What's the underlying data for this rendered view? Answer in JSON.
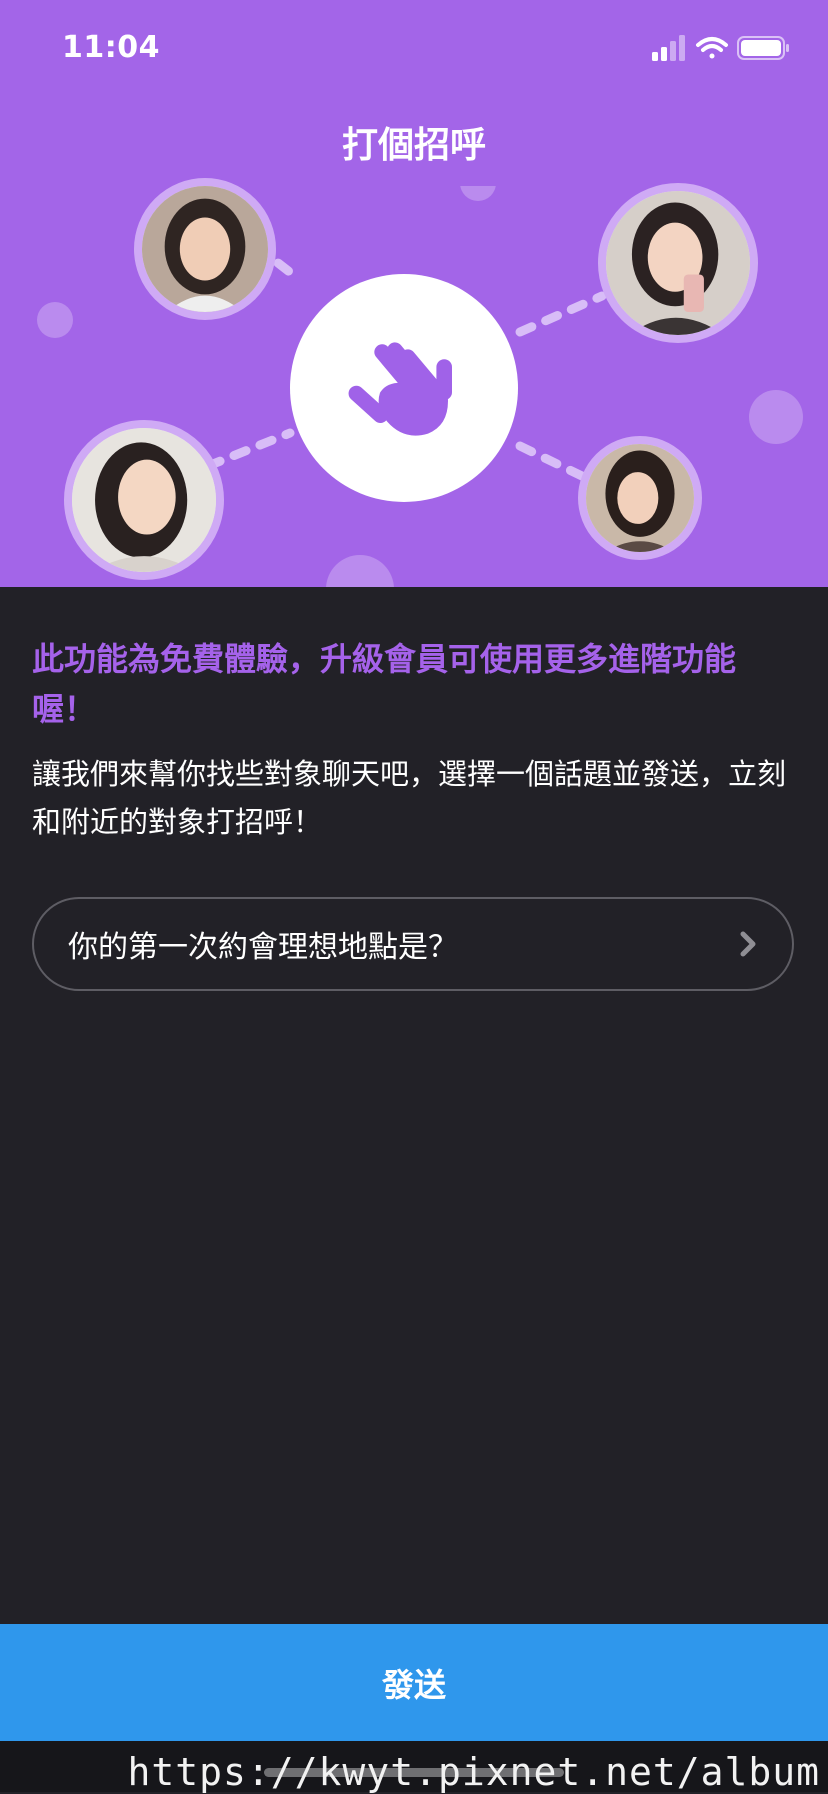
{
  "status_bar": {
    "time": "11:04",
    "icons": [
      "cellular-signal-icon",
      "wifi-icon",
      "battery-icon"
    ]
  },
  "header": {
    "title": "打個招呼"
  },
  "illustration": {
    "center_icon": "waving-hand-icon",
    "avatars": [
      "avatar-photo",
      "avatar-photo",
      "avatar-photo",
      "avatar-photo"
    ]
  },
  "content": {
    "headline": "此功能為免費體驗，升級會員可使用更多進階功能喔！",
    "description": "讓我們來幫你找些對象聊天吧，選擇一個話題並發送，立刻和附近的對象打招呼！"
  },
  "topic_selector": {
    "value": "你的第一次約會理想地點是？",
    "icon": "chevron-right-icon"
  },
  "footer": {
    "send_label": "發送",
    "watermark": "https://kwyt.pixnet.net/album"
  },
  "colors": {
    "hero_background": "#a365e8",
    "page_background": "#222127",
    "headline": "#a562ea",
    "send_button": "#2f97ec"
  }
}
